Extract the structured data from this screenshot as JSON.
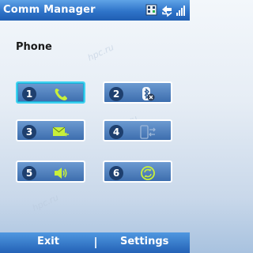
{
  "title_bar": {
    "title": "Comm Manager",
    "tray_icons": [
      "network-status-icon",
      "connectivity-icon",
      "signal-strength-icon"
    ]
  },
  "section": {
    "label": "Phone"
  },
  "buttons": [
    {
      "number": "1",
      "icon": "phone-icon",
      "selected": true
    },
    {
      "number": "2",
      "icon": "bluetooth-off-icon",
      "selected": false
    },
    {
      "number": "3",
      "icon": "mail-incoming-icon",
      "selected": false
    },
    {
      "number": "4",
      "icon": "activesync-device-icon",
      "selected": false
    },
    {
      "number": "5",
      "icon": "speaker-icon",
      "selected": false
    },
    {
      "number": "6",
      "icon": "sync-icon",
      "selected": false
    }
  ],
  "softkeys": {
    "left": "Exit",
    "right": "Settings"
  },
  "colors": {
    "title_bar": "#2f74c9",
    "button_fill": "#4f7fbe",
    "selected_border": "#3ed2f0",
    "icon_green": "#c8f03a"
  }
}
